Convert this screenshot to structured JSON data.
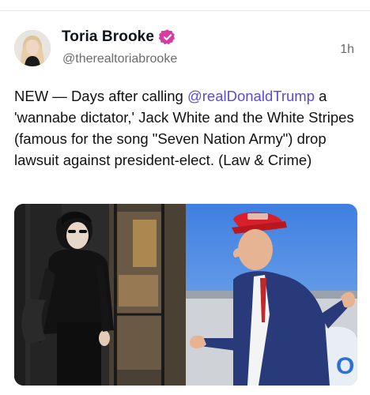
{
  "post": {
    "author_name": "Toria Brooke",
    "handle": "@therealtoriabrooke",
    "timestamp": "1h",
    "text_before": "NEW — Days after calling ",
    "mention": "@realDonaldTrump",
    "text_after": " a 'wannabe dictator,' Jack White and the White Stripes (famous for the song \"Seven Nation Army\") drop lawsuit against president-elect. (Law & Crime)",
    "verified_badge_icon": "verified-check-icon",
    "verified_color": "#d83aa4",
    "mention_color": "#5a4bd6"
  },
  "media": {
    "left_photo": "man-in-black-with-guitar-photo",
    "right_photo": "man-in-red-cap-navy-suit-photo"
  }
}
